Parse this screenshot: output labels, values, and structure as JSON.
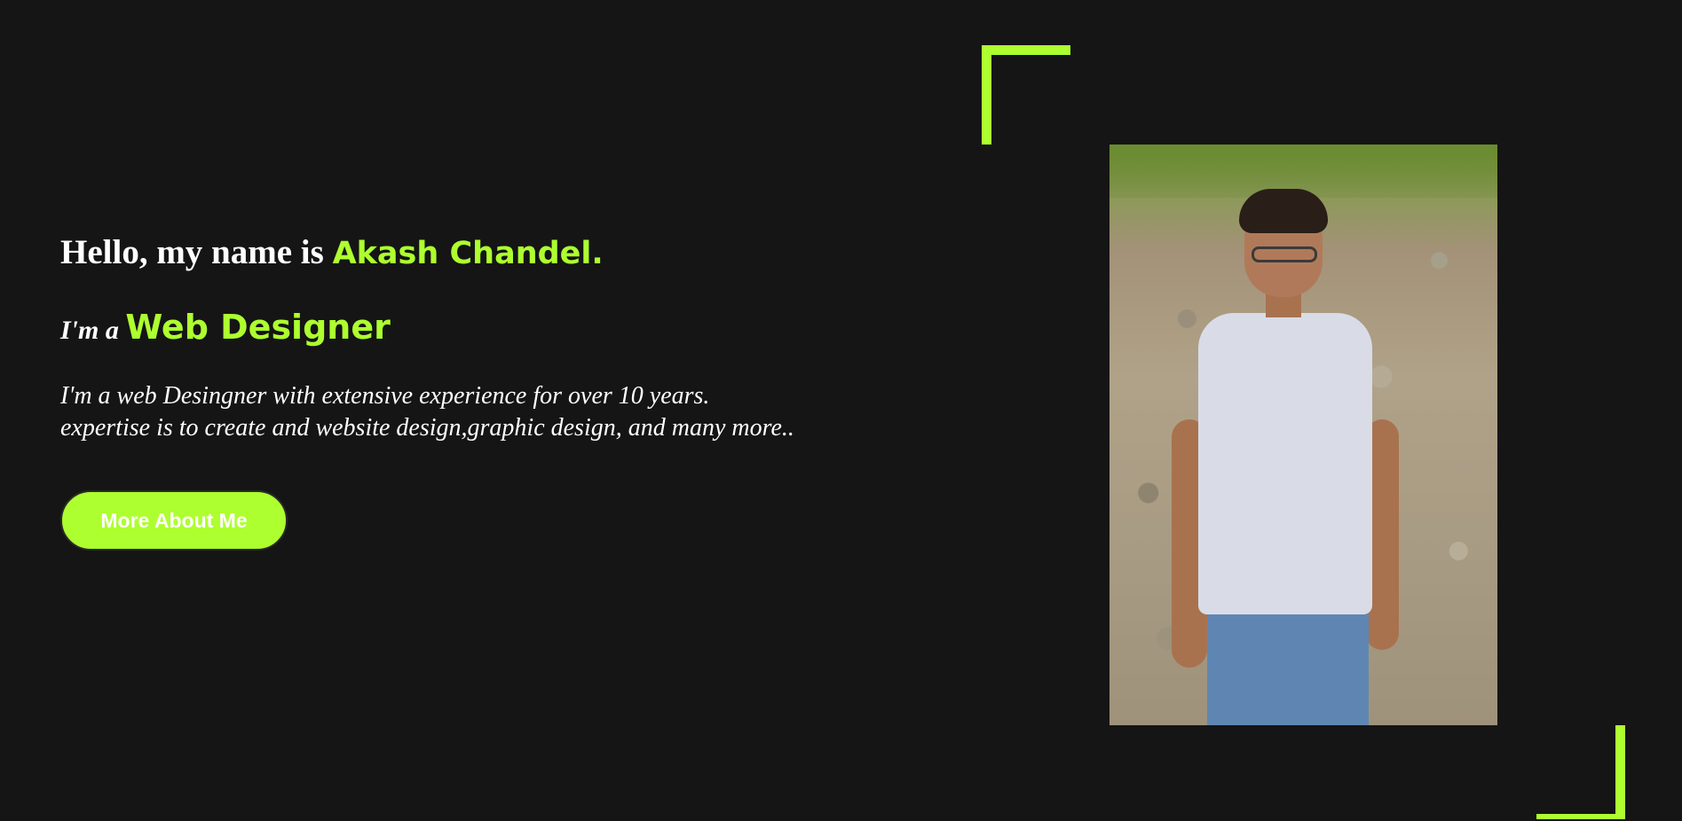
{
  "hero": {
    "greeting_prefix": "Hello, my name is",
    "name": "Akash Chandel.",
    "role_prefix": "I'm a",
    "role": "Web Designer",
    "bio_line_1": "I'm a web Desingner with extensive experience for over 10 years.",
    "bio_line_2": "expertise is to create and website design,graphic design, and many more..",
    "button_label": "More About Me"
  },
  "theme": {
    "background": "#151515",
    "accent": "#adff2f",
    "text": "#ffffff"
  }
}
